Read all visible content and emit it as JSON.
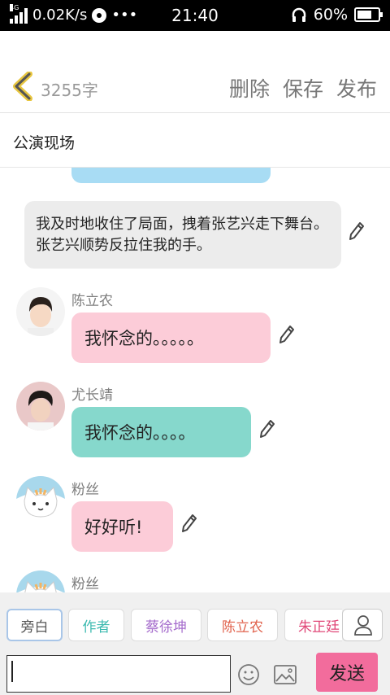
{
  "status_bar": {
    "net_type": "4G",
    "speed": "0.02K/s",
    "dots": "•••",
    "time": "21:40",
    "battery": "60%"
  },
  "header": {
    "word_count": "3255字",
    "actions": [
      "删除",
      "保存",
      "发布"
    ]
  },
  "title": "公演现场",
  "chat": {
    "narration": "我及时地收住了局面，拽着张艺兴走下舞台。张艺兴顺势反拉住我的手。",
    "messages": [
      {
        "name": "陈立农",
        "text": "我怀念的。。。。。",
        "color": "#fcccd8"
      },
      {
        "name": "尤长靖",
        "text": "我怀念的。。。。",
        "color": "#86d8cc"
      },
      {
        "name": "粉丝",
        "text": "好好听!",
        "color": "#fcccd8"
      },
      {
        "name": "粉丝",
        "text": "",
        "color": "#fcccd8"
      }
    ]
  },
  "roles": [
    {
      "label": "旁白",
      "color": "#555555"
    },
    {
      "label": "作者",
      "color": "#3cbab0"
    },
    {
      "label": "蔡徐坤",
      "color": "#a56ccc"
    },
    {
      "label": "陈立农",
      "color": "#e0604a"
    },
    {
      "label": "朱正廷",
      "color": "#e04878"
    }
  ],
  "input": {
    "value": "",
    "send_label": "发送"
  },
  "colors": {
    "send_button": "#f26c9c",
    "partial_bubble": "#a8dcf4",
    "narration_bg": "#ececec"
  }
}
